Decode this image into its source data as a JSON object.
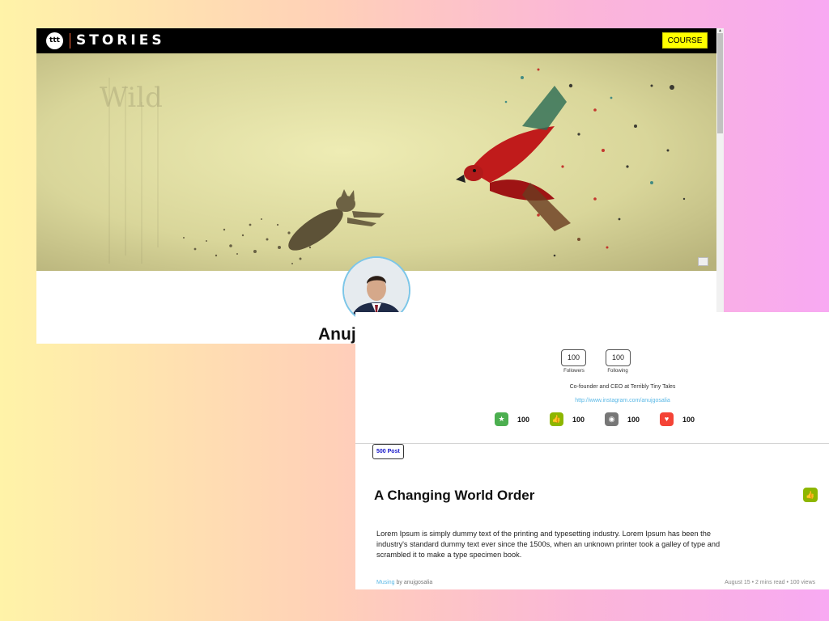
{
  "header": {
    "logo_text": "ttt",
    "brand": "STORIES",
    "course_label": "COURSE"
  },
  "cover": {
    "watermark_text": "Wild"
  },
  "profile": {
    "name": "Anuj Gosalia",
    "verified_icon": "check-badge-icon",
    "followers": "100",
    "followers_label": "Followers",
    "following": "100",
    "following_label": "Following",
    "bio": "Co-founder and CEO at Terribly Tiny Tales",
    "link": "http://www.instagram.com/anujgosalia",
    "metrics": [
      {
        "icon": "star-icon",
        "color": "#4caf50",
        "value": "100"
      },
      {
        "icon": "thumbs-up-icon",
        "color": "#8db600",
        "value": "100"
      },
      {
        "icon": "eye-icon",
        "color": "#777777",
        "value": "100"
      },
      {
        "icon": "heart-icon",
        "color": "#f44336",
        "value": "100"
      }
    ]
  },
  "posts": {
    "count_label": "500 Post",
    "items": [
      {
        "title": "A Changing World Order",
        "body": "Lorem Ipsum is simply dummy text of the printing and typesetting industry. Lorem Ipsum has been the industry's standard dummy text ever since the 1500s, when an unknown printer took a galley of type and scrambled it to make a type specimen book.",
        "category": "Musing",
        "author_prefix": " by ",
        "author": "anujgosalia",
        "meta": "August 15 • 2 mins read • 100 views"
      }
    ]
  },
  "colors": {
    "course_button": "#ffff00",
    "link": "#5ab8e6",
    "like_button": "#8db600",
    "badge_text": "#1414c8"
  }
}
